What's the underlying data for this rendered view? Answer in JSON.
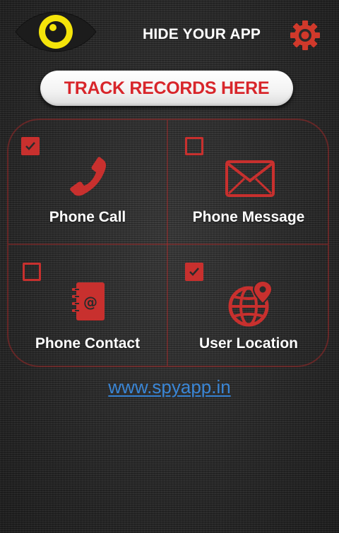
{
  "header": {
    "title": "HIDE YOUR APP",
    "logo_icon": "eye-icon",
    "settings_icon": "gear-icon"
  },
  "track_button": {
    "label": "TRACK RECORDS HERE"
  },
  "tiles": [
    {
      "label": "Phone Call",
      "icon": "phone-icon",
      "checked": true
    },
    {
      "label": "Phone Message",
      "icon": "envelope-icon",
      "checked": false
    },
    {
      "label": "Phone Contact",
      "icon": "contact-book-icon",
      "checked": false
    },
    {
      "label": "User Location",
      "icon": "globe-location-icon",
      "checked": true
    }
  ],
  "footer": {
    "link_text": "www.spyapp.in"
  },
  "colors": {
    "accent_red": "#c8302e",
    "logo_yellow": "#f4e40a",
    "link_blue": "#3a86d6"
  }
}
